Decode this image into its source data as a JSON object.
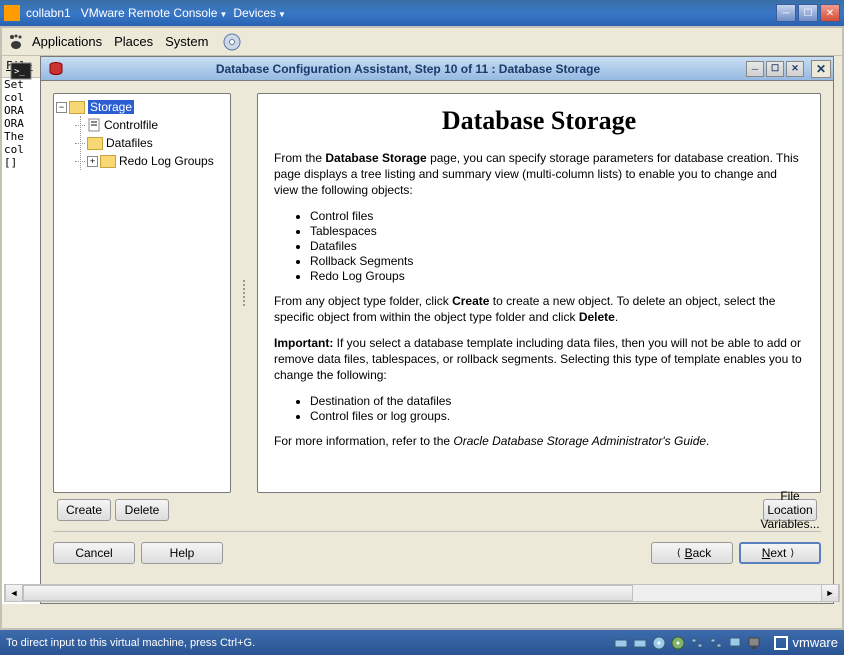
{
  "vmware": {
    "host_label": "collabn1",
    "menu_console": "VMware Remote Console",
    "menu_devices": "Devices",
    "status_hint": "To direct input to this virtual machine, press Ctrl+G.",
    "brand": "vmware"
  },
  "gnome": {
    "applications": "Applications",
    "places": "Places",
    "system": "System"
  },
  "terminal": {
    "menu_file": "File",
    "lines": [
      "Set",
      "col",
      "ORA",
      "ORA",
      "The",
      "col",
      "[]"
    ]
  },
  "dbca": {
    "title": "Database Configuration Assistant, Step 10 of 11 : Database Storage",
    "tree": {
      "root": "Storage",
      "children": [
        "Controlfile",
        "Datafiles",
        "Redo Log Groups"
      ]
    },
    "content": {
      "heading": "Database Storage",
      "para1_a": "From the ",
      "para1_b": "Database Storage",
      "para1_c": " page, you can specify storage parameters for database creation. This page displays a tree listing and summary view (multi-column lists) to enable you to change and view the following objects:",
      "list1": [
        "Control files",
        "Tablespaces",
        "Datafiles",
        "Rollback Segments",
        "Redo Log Groups"
      ],
      "para2_a": "From any object type folder, click ",
      "para2_b": "Create",
      "para2_c": " to create a new object. To delete an object, select the specific object from within the object type folder and click ",
      "para2_d": "Delete",
      "para2_e": ".",
      "para3_a": "Important:",
      "para3_b": " If you select a database template including data files, then you will not be able to add or remove data files, tablespaces, or rollback segments. Selecting this type of template enables you to change the following:",
      "list2": [
        "Destination of the datafiles",
        "Control files or log groups."
      ],
      "para4_a": "For more information, refer to the ",
      "para4_b": "Oracle Database Storage Administrator's Guide",
      "para4_c": "."
    },
    "buttons": {
      "create": "Create",
      "delete": "Delete",
      "file_loc_vars": "File Location Variables...",
      "cancel": "Cancel",
      "help": "Help",
      "back": "Back",
      "next": "Next"
    }
  }
}
